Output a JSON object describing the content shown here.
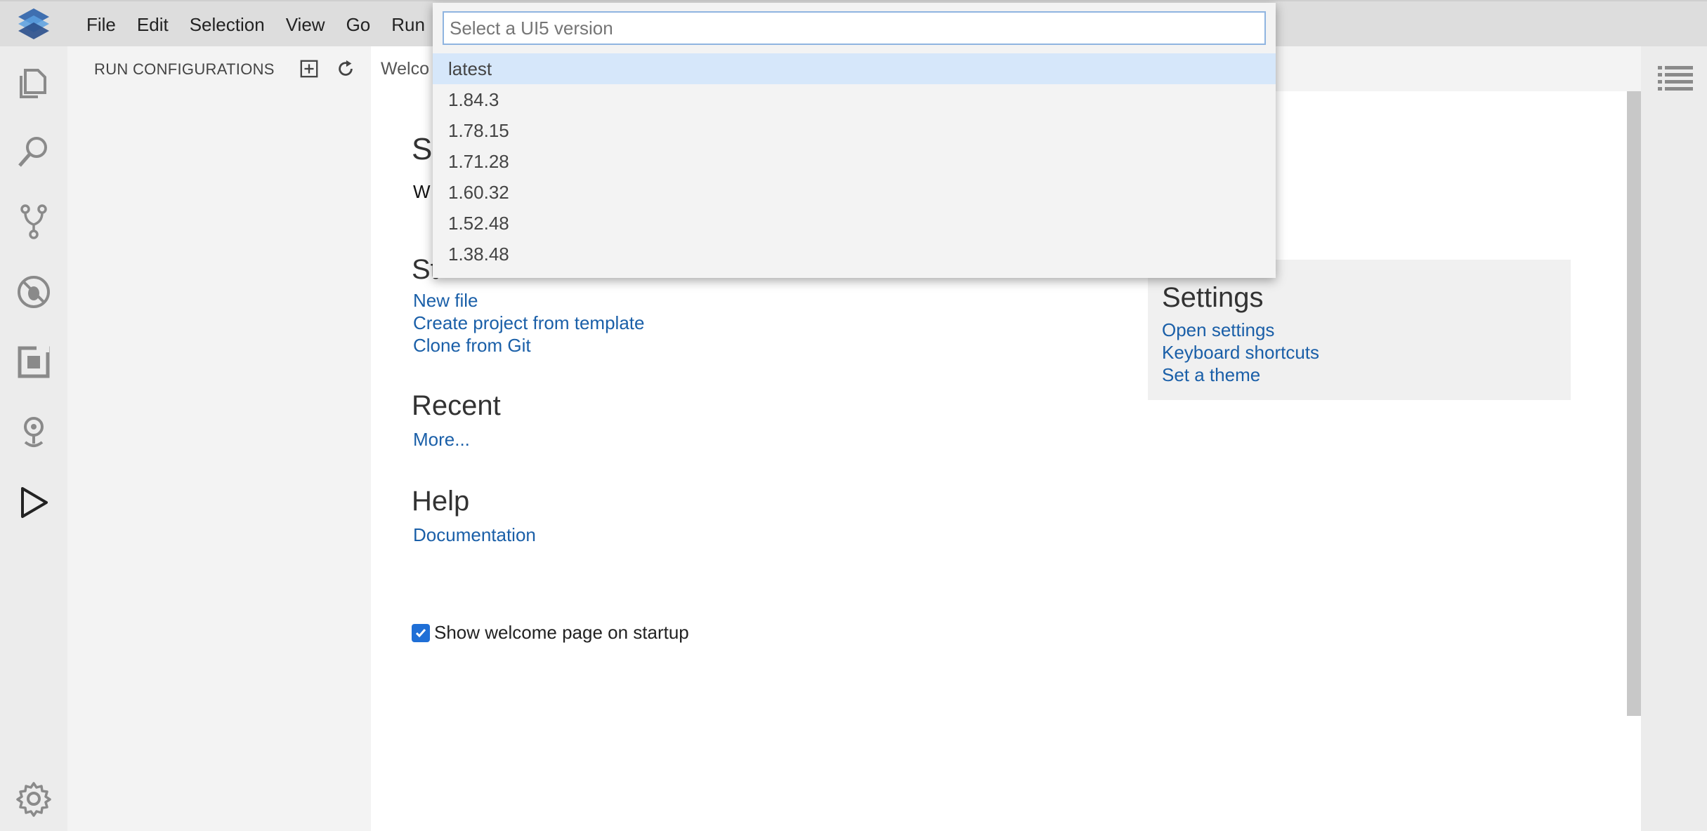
{
  "menubar": {
    "items": [
      "File",
      "Edit",
      "Selection",
      "View",
      "Go",
      "Run"
    ]
  },
  "activitybar": {
    "icons": [
      "explorer-icon",
      "search-icon",
      "source-control-icon",
      "debug-icon",
      "extensions-icon",
      "remote-explorer-icon",
      "run-configurations-icon"
    ],
    "bottom_icon": "settings-gear-icon"
  },
  "sidepanel": {
    "title": "RUN CONFIGURATIONS",
    "actions": [
      "add-configuration-icon",
      "refresh-icon"
    ]
  },
  "editor": {
    "tab_label": "Welco",
    "welcome": {
      "title_fragment": "S",
      "subtitle_fragment": "W",
      "start_heading_fragment": "St",
      "start_links": [
        "New file",
        "Create project from template",
        "Clone from Git"
      ],
      "recent_heading": "Recent",
      "recent_links": [
        "More..."
      ],
      "help_heading": "Help",
      "help_links": [
        "Documentation"
      ],
      "settings_heading": "Settings",
      "settings_links": [
        "Open settings",
        "Keyboard shortcuts",
        "Set a theme"
      ],
      "startup_checkbox_label": "Show welcome page on startup",
      "startup_checked": true
    }
  },
  "quickpick": {
    "placeholder": "Select a UI5 version",
    "value": "",
    "items": [
      "latest",
      "1.84.3",
      "1.78.15",
      "1.71.28",
      "1.60.32",
      "1.52.48",
      "1.38.48"
    ],
    "selected_index": 0
  },
  "colors": {
    "link": "#1a5fa8",
    "accent": "#1f6fd6",
    "selected_item": "#d6e7fa"
  }
}
